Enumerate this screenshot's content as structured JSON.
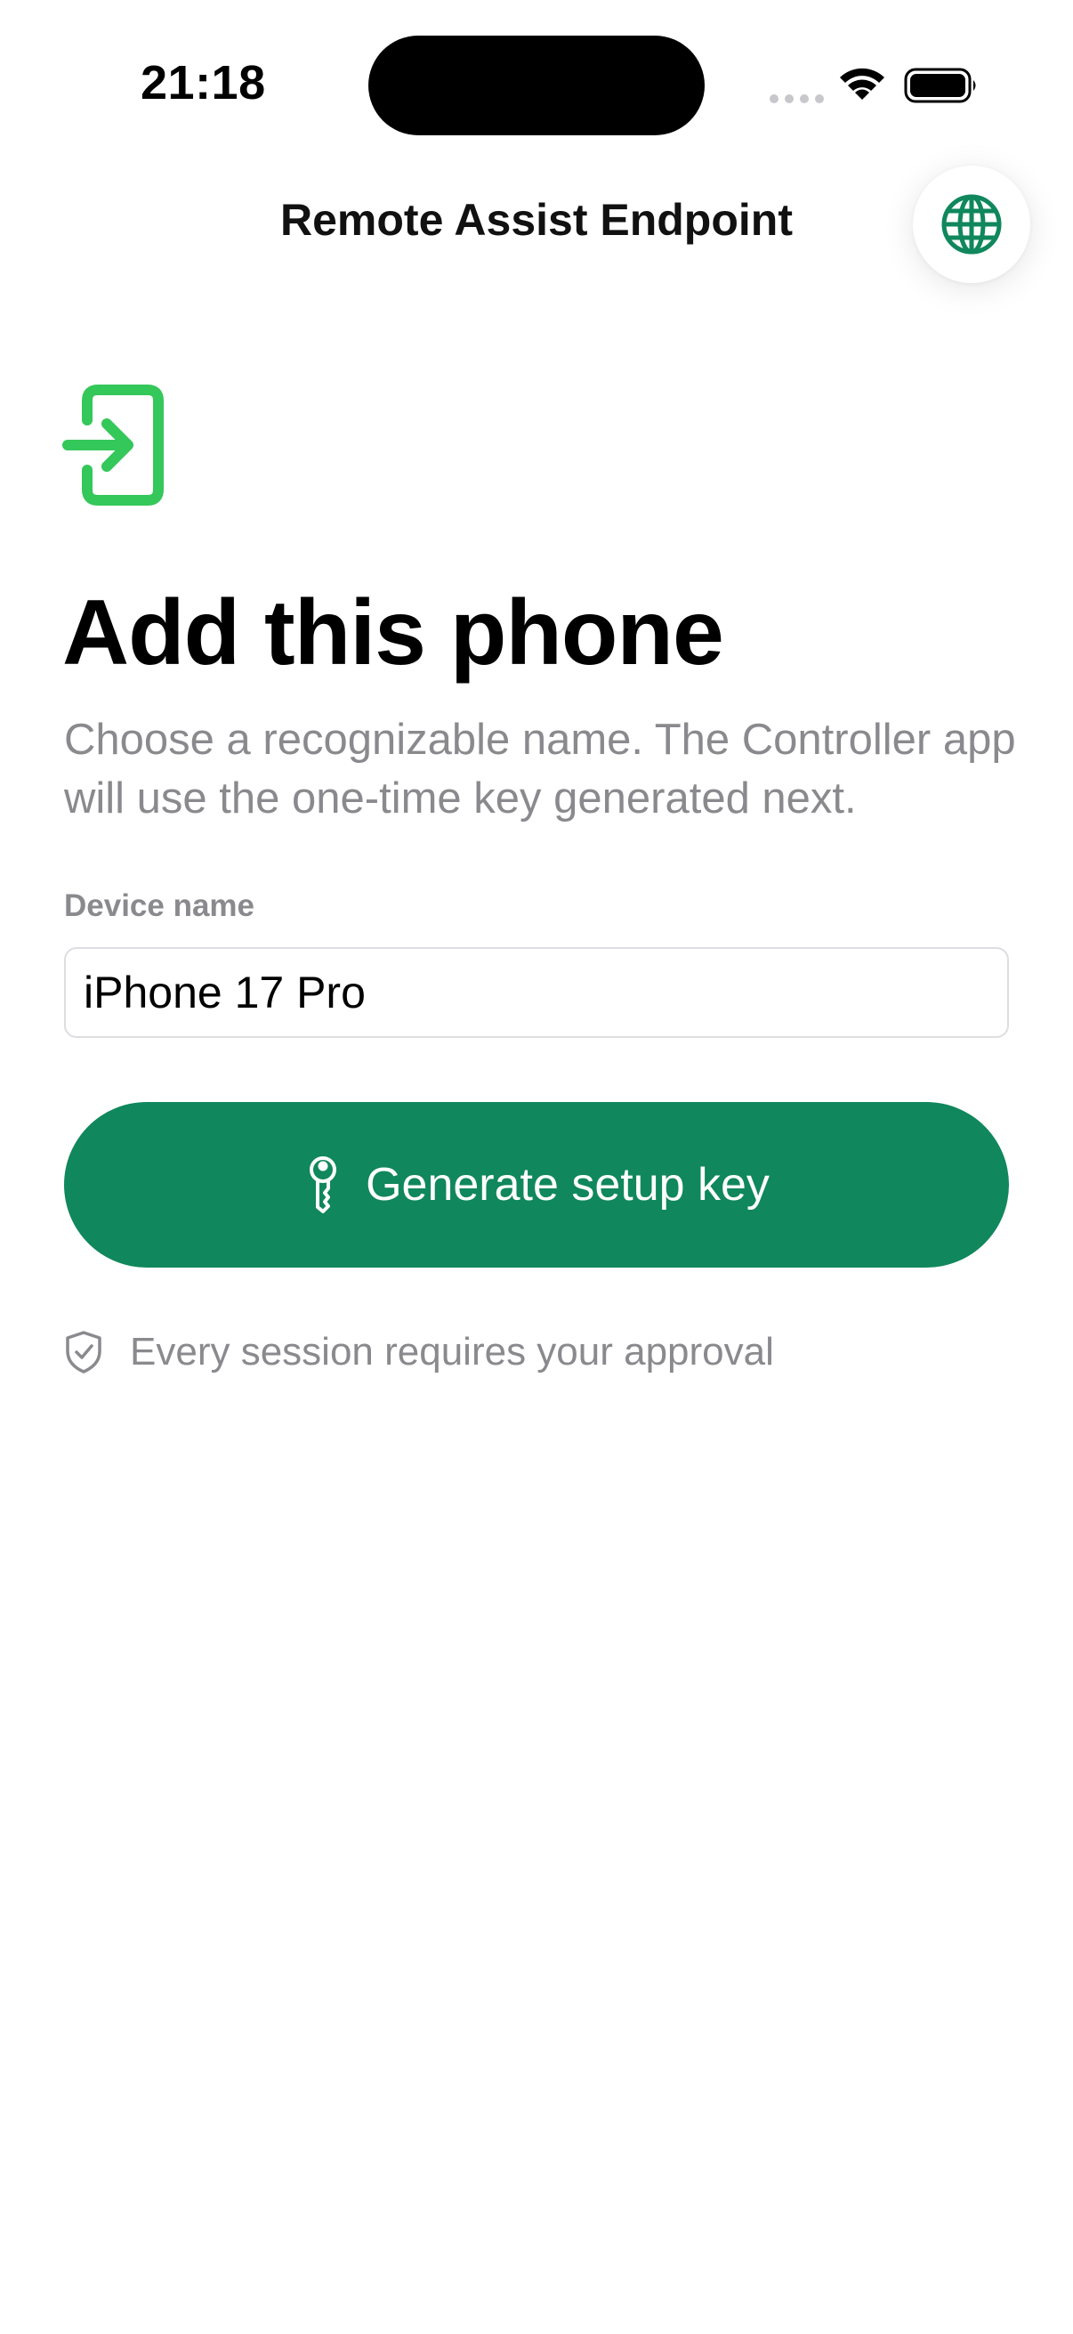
{
  "status_bar": {
    "time": "21:18"
  },
  "nav": {
    "title": "Remote Assist Endpoint",
    "language_icon": "globe-icon"
  },
  "hero": {
    "icon": "phone-login-icon",
    "title": "Add this phone",
    "subtitle": "Choose a recognizable name. The Controller app will use the one-time key generated next."
  },
  "form": {
    "device_name_label": "Device name",
    "device_name_value": "iPhone 17 Pro"
  },
  "primary_button": {
    "icon": "key-icon",
    "label": "Generate setup key"
  },
  "note": {
    "icon": "shield-check-icon",
    "text": "Every session requires your approval"
  },
  "colors": {
    "accent": "#10875d",
    "hero_icon": "#34c759",
    "secondary_text": "#8a8a8e"
  }
}
